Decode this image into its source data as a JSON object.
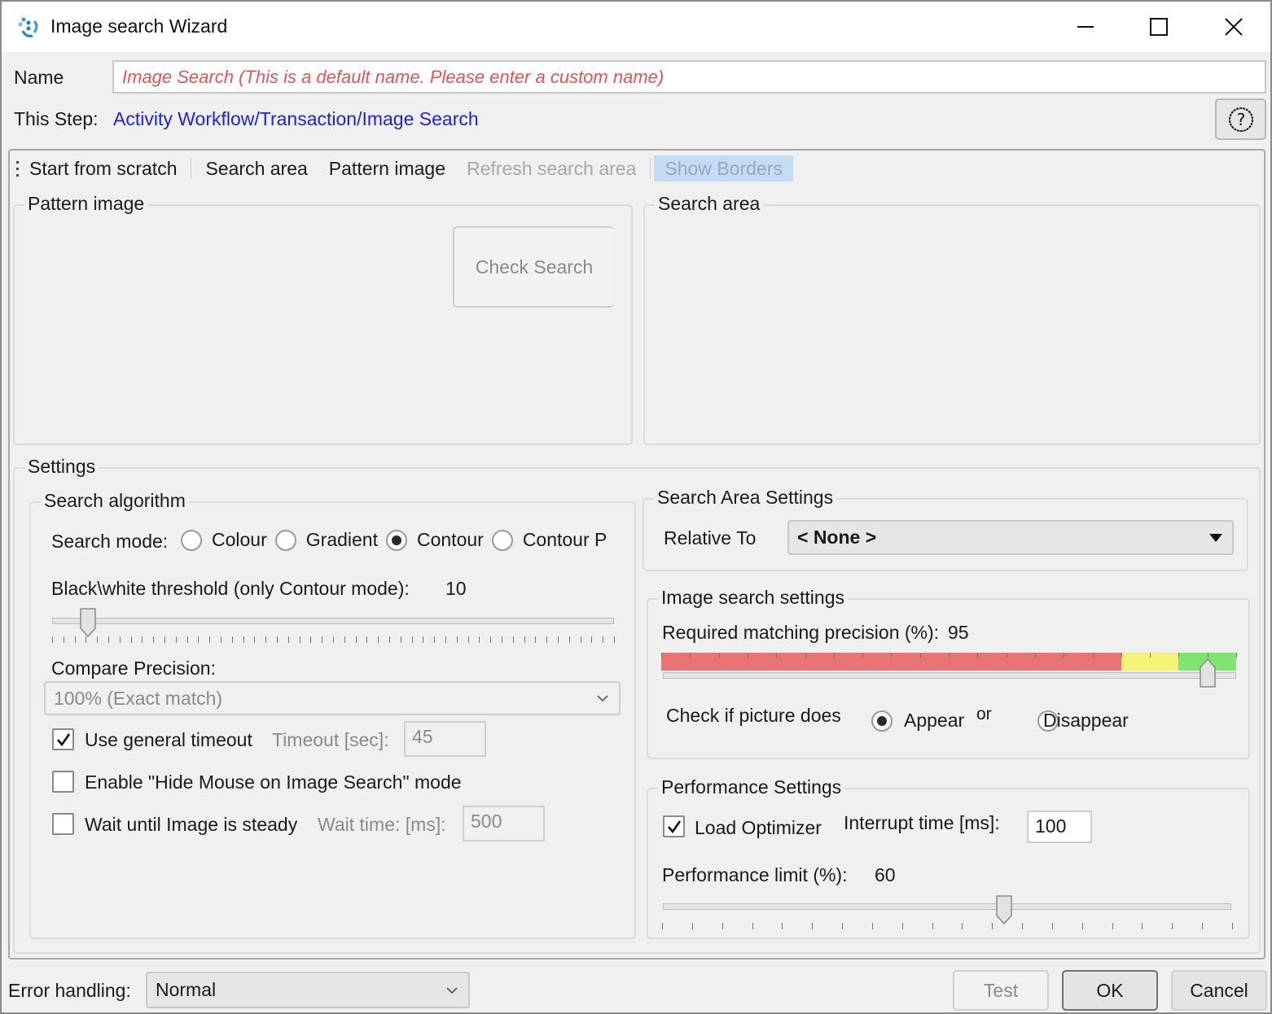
{
  "window": {
    "title": "Image search Wizard",
    "controls": {
      "minimize": "minimize",
      "maximize": "maximize",
      "close": "close"
    }
  },
  "header": {
    "name_label": "Name",
    "name_placeholder": "Image Search  (This is a default name. Please enter a custom name)",
    "step_label": "This Step:",
    "step_path": "Activity Workflow/Transaction/Image Search",
    "help_icon": "question-circle-icon"
  },
  "toolbar": {
    "items": [
      {
        "label": "Start from scratch",
        "state": "enabled"
      },
      {
        "label": "Search area",
        "state": "enabled"
      },
      {
        "label": "Pattern image",
        "state": "enabled"
      },
      {
        "label": "Refresh search area",
        "state": "disabled"
      },
      {
        "label": "Show Borders",
        "state": "highlighted-disabled"
      }
    ]
  },
  "pattern_panel": {
    "title": "Pattern image",
    "check_search_label": "Check Search"
  },
  "search_panel": {
    "title": "Search area"
  },
  "settings": {
    "title": "Settings",
    "algorithm": {
      "title": "Search algorithm",
      "mode_label": "Search mode:",
      "modes": [
        {
          "label": "Colour",
          "checked": false
        },
        {
          "label": "Gradient",
          "checked": false
        },
        {
          "label": "Contour",
          "checked": true
        },
        {
          "label": "Contour P",
          "checked": false
        }
      ],
      "threshold_label": "Black\\white threshold (only Contour mode):",
      "threshold_value": "10",
      "threshold_fraction": 0.04,
      "compare_label": "Compare Precision:",
      "compare_value": "100% (Exact match)",
      "general_timeout": {
        "label": "Use general timeout",
        "checked": true,
        "field_label": "Timeout [sec]:",
        "value": "45"
      },
      "hide_mouse": {
        "label": "Enable \"Hide Mouse on Image Search\" mode",
        "checked": false
      },
      "wait_steady": {
        "label": "Wait until Image is steady",
        "checked": false,
        "field_label": "Wait time: [ms]:",
        "value": "500"
      }
    },
    "search_area": {
      "title": "Search Area Settings",
      "relative_label": "Relative To",
      "relative_value": "< None >"
    },
    "image_search": {
      "title": "Image search settings",
      "precision_label": "Required matching precision (%):",
      "precision_value": "95",
      "precision_percent": 95,
      "zone_colors": {
        "low": "#e87474",
        "mid": "#f4f47a",
        "high": "#80e470"
      },
      "check_label": "Check if picture does",
      "appear_label": "Appear",
      "or_label": "or",
      "disappear_label": "Disappear",
      "appear_checked": true
    },
    "performance": {
      "title": "Performance Settings",
      "optimizer_label": "Load Optimizer",
      "optimizer_checked": true,
      "interrupt_label": "Interrupt time [ms]:",
      "interrupt_value": "100",
      "limit_label": "Performance limit (%):",
      "limit_value": "60",
      "limit_fraction": 0.6
    }
  },
  "footer": {
    "error_label": "Error handling:",
    "error_value": "Normal",
    "test_label": "Test",
    "ok_label": "OK",
    "cancel_label": "Cancel"
  }
}
